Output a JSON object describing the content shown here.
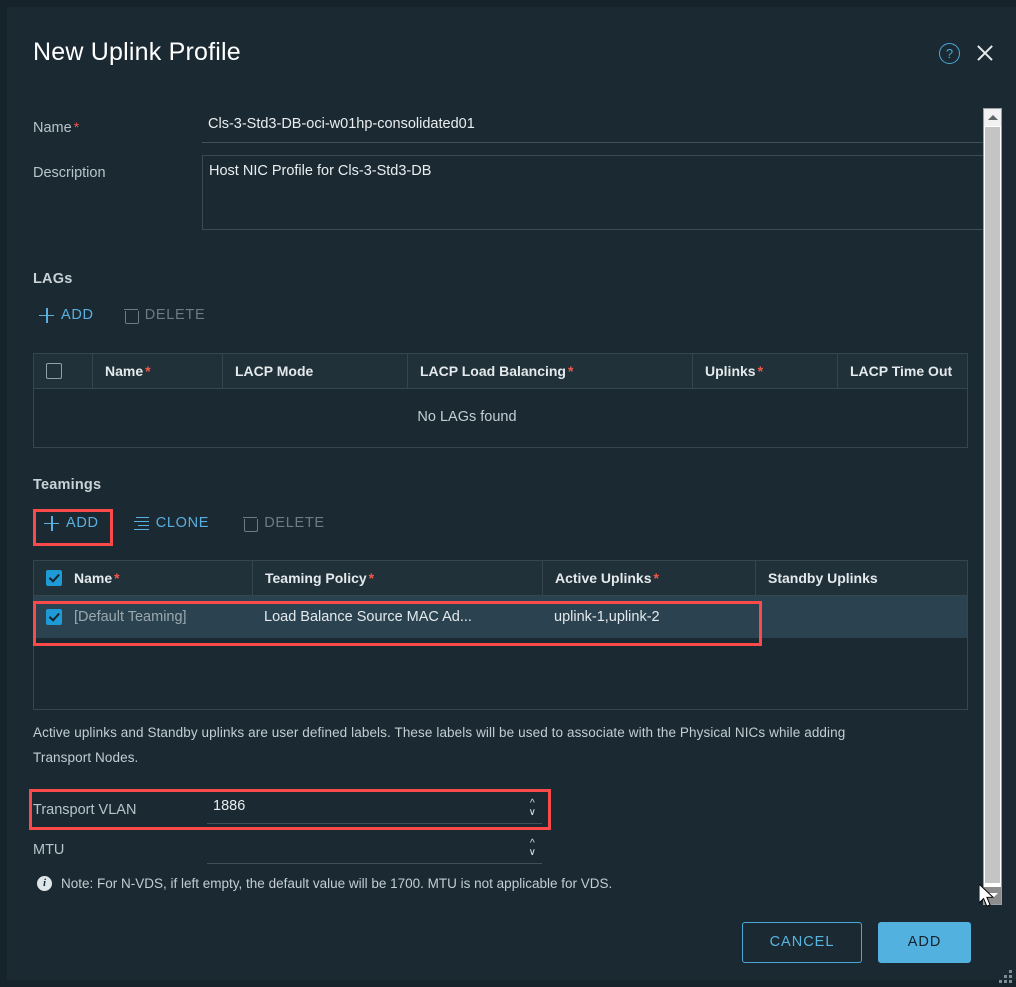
{
  "dialog": {
    "title": "New Uplink Profile",
    "help_icon": "help-circle-icon",
    "close_icon": "close-icon"
  },
  "form": {
    "name_label": "Name",
    "name_value": "Cls-3-Std3-DB-oci-w01hp-consolidated01",
    "description_label": "Description",
    "description_value": "Host NIC Profile for Cls-3-Std3-DB"
  },
  "lags": {
    "heading": "LAGs",
    "toolbar": {
      "add_label": "ADD",
      "delete_label": "DELETE"
    },
    "columns": [
      "Name",
      "LACP Mode",
      "LACP Load Balancing",
      "Uplinks",
      "LACP Time Out"
    ],
    "required_columns": [
      "Name",
      "LACP Load Balancing",
      "Uplinks"
    ],
    "empty_message": "No LAGs found",
    "header_checkbox_checked": false
  },
  "teamings": {
    "heading": "Teamings",
    "toolbar": {
      "add_label": "ADD",
      "clone_label": "CLONE",
      "delete_label": "DELETE"
    },
    "columns": [
      "Name",
      "Teaming Policy",
      "Active Uplinks",
      "Standby Uplinks"
    ],
    "required_columns": [
      "Name",
      "Teaming Policy",
      "Active Uplinks"
    ],
    "header_checkbox_checked": true,
    "rows": [
      {
        "checked": true,
        "name": "[Default Teaming]",
        "policy": "Load Balance Source MAC Ad...",
        "active_uplinks": "uplink-1,uplink-2",
        "standby_uplinks": ""
      }
    ]
  },
  "helper_text_line1": "Active uplinks and Standby uplinks are user defined labels. These labels will be used to associate with the Physical NICs while adding",
  "helper_text_line2": "Transport Nodes.",
  "transport_vlan": {
    "label": "Transport VLAN",
    "value": "1886"
  },
  "mtu": {
    "label": "MTU",
    "value": "",
    "note_icon": "info-icon",
    "note": "Note: For N-VDS, if left empty, the default value will be 1700. MTU is not applicable for VDS."
  },
  "footer": {
    "cancel_label": "CANCEL",
    "add_label": "ADD"
  },
  "colors": {
    "dialog_background": "#1b2a32",
    "accent_blue": "#53b1e0",
    "required_red": "#f2584a",
    "annotation_red": "#fb4a4a",
    "selected_row": "#2b4350",
    "checkbox_on": "#1e9ad6"
  },
  "annotations": [
    {
      "name": "teamings-add-highlight"
    },
    {
      "name": "teamings-row-highlight"
    },
    {
      "name": "transport-vlan-highlight"
    }
  ],
  "scrollbar": {
    "up_arrow": "chevron-up-icon",
    "down_arrow": "chevron-down-icon"
  }
}
